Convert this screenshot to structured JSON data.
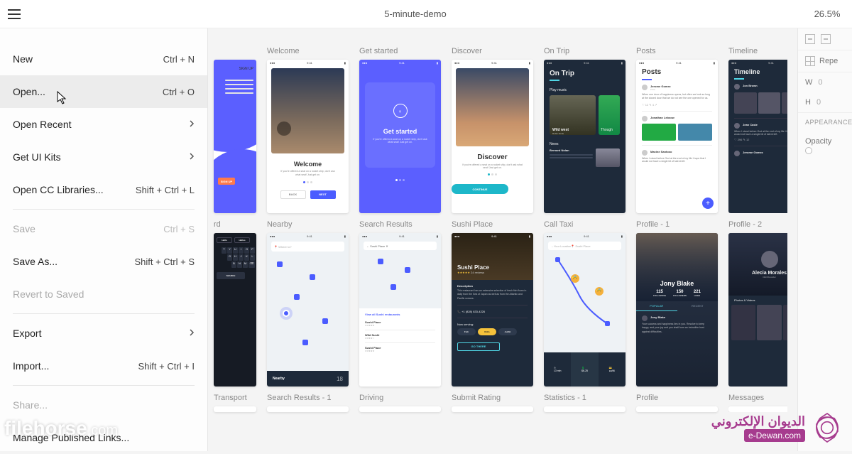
{
  "header": {
    "doc_title": "5-minute-demo",
    "zoom": "26.5%"
  },
  "menu": {
    "items": [
      {
        "label": "New",
        "shortcut": "Ctrl + N"
      },
      {
        "label": "Open...",
        "shortcut": "Ctrl + O",
        "hover": true
      },
      {
        "label": "Open Recent",
        "chevron": true
      },
      {
        "label": "Get UI Kits",
        "chevron": true
      },
      {
        "label": "Open CC Libraries...",
        "shortcut": "Shift + Ctrl + L"
      },
      "sep",
      {
        "label": "Save",
        "shortcut": "Ctrl + S",
        "disabled": true
      },
      {
        "label": "Save As...",
        "shortcut": "Shift + Ctrl + S"
      },
      {
        "label": "Revert to Saved",
        "disabled": true
      },
      "sep",
      {
        "label": "Export",
        "chevron": true
      },
      {
        "label": "Import...",
        "shortcut": "Shift + Ctrl + I"
      },
      "sep",
      {
        "label": "Share...",
        "disabled": true
      },
      {
        "label": "Manage Published Links..."
      }
    ]
  },
  "right_panel": {
    "repeat": "Repe",
    "w_label": "W",
    "w_value": "0",
    "h_label": "H",
    "h_value": "0",
    "appearance": "APPEARANCE",
    "opacity": "Opacity"
  },
  "artboards": {
    "row1": [
      {
        "label": ""
      },
      {
        "label": "Welcome"
      },
      {
        "label": "Get started"
      },
      {
        "label": "Discover"
      },
      {
        "label": "On Trip"
      },
      {
        "label": "Posts"
      },
      {
        "label": "Timeline"
      }
    ],
    "row2": [
      {
        "label": "rd"
      },
      {
        "label": "Nearby"
      },
      {
        "label": "Search Results"
      },
      {
        "label": "Sushi Place"
      },
      {
        "label": "Call Taxi"
      },
      {
        "label": "Profile - 1"
      },
      {
        "label": "Profile - 2"
      }
    ],
    "row3": [
      {
        "label": "Transport"
      },
      {
        "label": "Search Results - 1"
      },
      {
        "label": "Driving"
      },
      {
        "label": "Submit Rating"
      },
      {
        "label": "Statistics - 1"
      },
      {
        "label": "Profile"
      },
      {
        "label": "Messages"
      }
    ]
  },
  "screens": {
    "signup": {
      "tab": "SIGN UP",
      "cta": "SIGN UP"
    },
    "welcome": {
      "title": "Welcome",
      "back": "BACK",
      "next": "NEXT"
    },
    "getstarted": {
      "title": "Get started"
    },
    "discover": {
      "title": "Discover",
      "cta": "CONTINUE"
    },
    "ontrip": {
      "title": "On Trip",
      "sub": "Play music",
      "card1": "Wild west",
      "card1b": "Robin Smile",
      "card2": "Though",
      "news": "News"
    },
    "posts": {
      "title": "Posts"
    },
    "timeline": {
      "title": "Timeline"
    },
    "nearby": {
      "pill": "Nearby",
      "count": "18"
    },
    "searchresults": {
      "title": "View all Sushi restaurants",
      "items": [
        "Sushi Place",
        "Wild Sushi",
        "Sushi Place"
      ]
    },
    "sushi": {
      "title": "Sushi Place",
      "reviews": "24 reviews",
      "desc": "Description",
      "phone": "+1 (828) 833-4226",
      "hours": "Now serving:"
    },
    "calltaxi": {
      "loc": "Your Location"
    },
    "profile1": {
      "name": "Jony Blake",
      "following": "FOLLOWING",
      "followers": "FOLLOWERS",
      "likes": "LIKES",
      "n1": "115",
      "n2": "150",
      "n3": "221",
      "popular": "POPULAR",
      "recent": "RECENT"
    },
    "profile2": {
      "name": "Alecia Morales",
      "photos": "Photos & Videos"
    }
  },
  "watermark_left": {
    "brand": "filehorse",
    "suffix": ".com"
  },
  "watermark_right": {
    "arabic": "الديوان الإلكتروني",
    "latin": "e-Dewan.com"
  }
}
